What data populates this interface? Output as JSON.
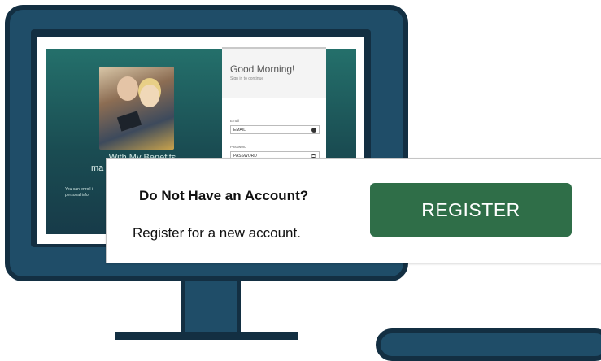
{
  "login_screen": {
    "greeting": "Good Morning!",
    "signin_hint": "Sign in to continue",
    "email_label": "Email",
    "email_placeholder": "EMAIL",
    "password_label": "Password",
    "password_placeholder": "PASSWORD",
    "left_heading": "With My Benefits",
    "left_heading_fragment": "ma",
    "left_small_text": "You can enroll i personal infor"
  },
  "callout": {
    "title": "Do Not Have an Account?",
    "subtitle": "Register for a new account.",
    "register_label": "REGISTER"
  },
  "colors": {
    "monitor_frame": "#132f42",
    "monitor_body": "#1f4d68",
    "app_gradient_top": "#24706b",
    "register_button": "#2f6e48"
  }
}
